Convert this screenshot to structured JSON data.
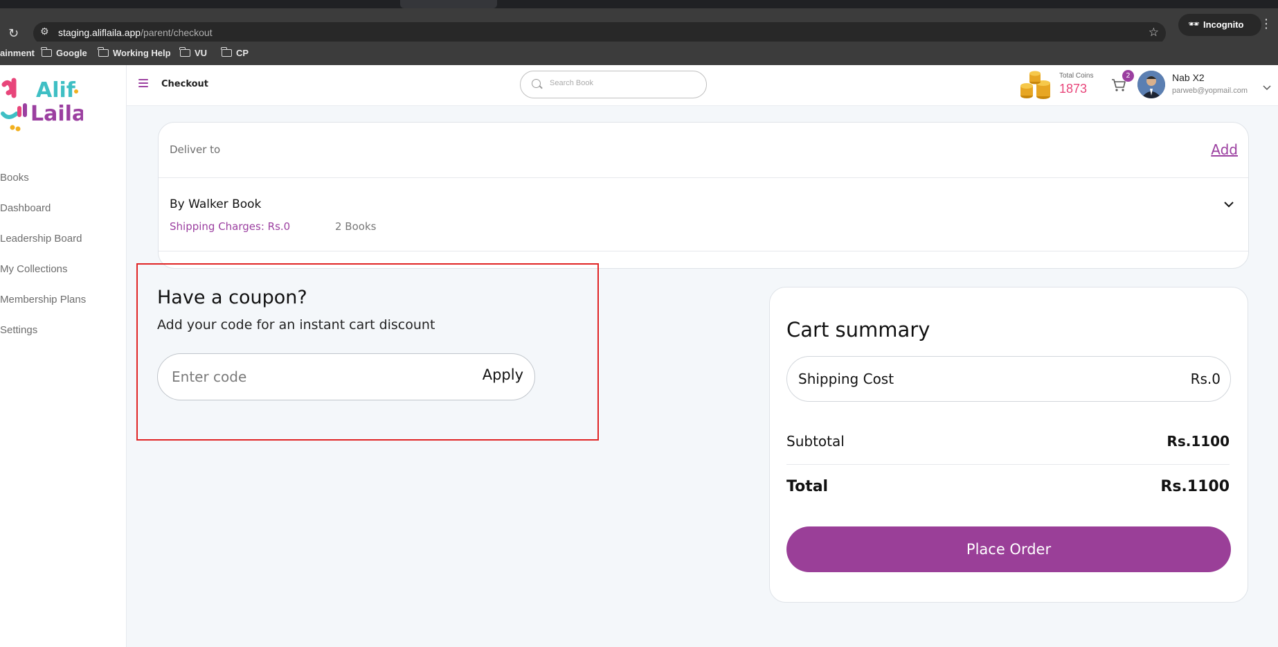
{
  "browser": {
    "url_host": "staging.aliflaila.app",
    "url_path": "/parent/checkout",
    "profile_label": "Incognito",
    "bookmarks": [
      "ainment",
      "Google",
      "Working Help",
      "VU",
      "CP"
    ]
  },
  "sidebar": {
    "logo_text": "Alif Laila",
    "nav": [
      "Books",
      "Dashboard",
      "Leadership Board",
      "My Collections",
      "Membership Plans",
      "Settings"
    ]
  },
  "header": {
    "title": "Checkout",
    "search_placeholder": "Search Book",
    "coins_label": "Total Coins",
    "coins_value": "1873",
    "cart_count": "2",
    "user_name": "Nab X2",
    "user_email": "parweb@yopmail.com"
  },
  "delivery": {
    "label": "Deliver to",
    "add_label": "Add",
    "vendor": "By Walker Book",
    "shipping_charges": "Shipping Charges: Rs.0",
    "books_count": "2 Books"
  },
  "coupon": {
    "title": "Have a coupon?",
    "subtitle": "Add your code for an instant cart discount",
    "placeholder": "Enter code",
    "apply_label": "Apply"
  },
  "summary": {
    "title": "Cart summary",
    "shipping_label": "Shipping Cost",
    "shipping_value": "Rs.0",
    "subtotal_label": "Subtotal",
    "subtotal_value": "Rs.1100",
    "total_label": "Total",
    "total_value": "Rs.1100",
    "place_order_label": "Place Order"
  },
  "colors": {
    "brand_purple": "#9b3fa0",
    "coins_pink": "#e8457a",
    "highlight_red": "#e02424"
  }
}
